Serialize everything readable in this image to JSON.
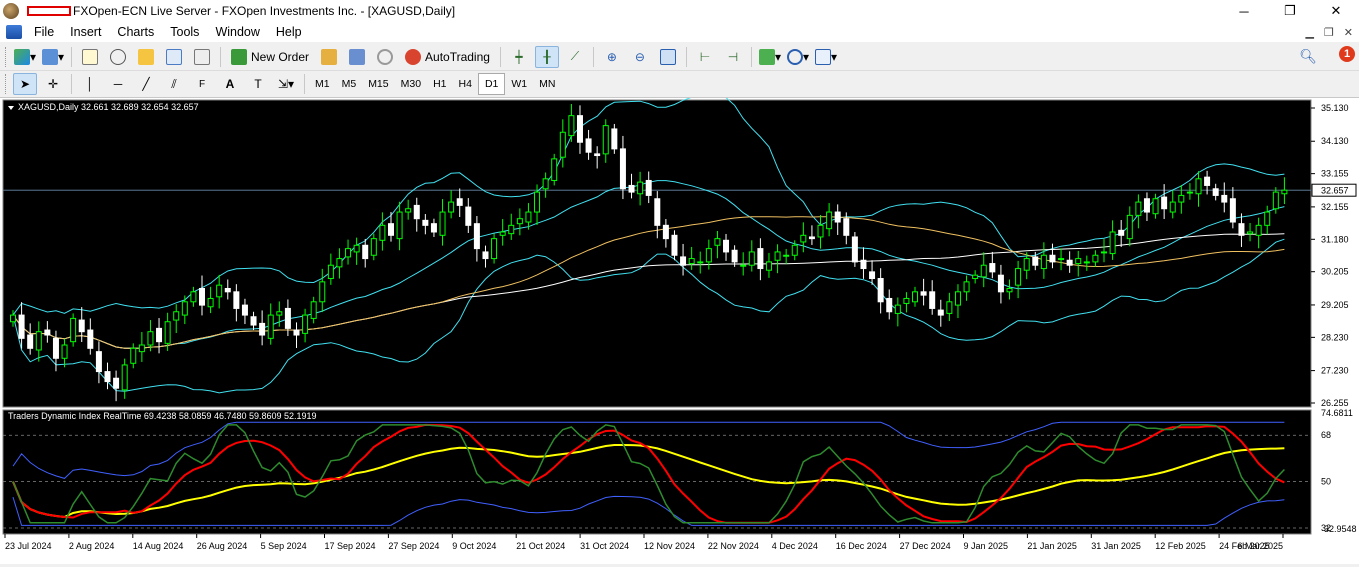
{
  "window": {
    "title": "FXOpen-ECN Live Server - FXOpen Investments Inc. - [XAGUSD,Daily]",
    "controls": [
      "─",
      "❐",
      "✕"
    ]
  },
  "menu": {
    "items": [
      "File",
      "Insert",
      "Charts",
      "Tools",
      "Window",
      "Help"
    ]
  },
  "toolbar": {
    "new_order": "New Order",
    "autotrading": "AutoTrading",
    "notification_count": "1"
  },
  "timeframes": [
    "M1",
    "M5",
    "M15",
    "M30",
    "H1",
    "H4",
    "D1",
    "W1",
    "MN"
  ],
  "selected_timeframe": "D1",
  "chart": {
    "symbol_label": "XAGUSD,Daily  32.661 32.689 32.654 32.657",
    "price_axis": [
      "35.130",
      "34.130",
      "33.155",
      "32.155",
      "31.180",
      "30.205",
      "29.205",
      "28.230",
      "27.230",
      "26.255"
    ],
    "current_price": "32.657",
    "indicator_label": "Traders Dynamic Index RealTime 69.4238 58.0859 46.7480 59.8609 52.1919",
    "indicator_axis": [
      "74.6811",
      "68",
      "50",
      "32",
      "32.9548"
    ],
    "date_axis": [
      "23 Jul 2024",
      "2 Aug 2024",
      "14 Aug 2024",
      "26 Aug 2024",
      "5 Sep 2024",
      "17 Sep 2024",
      "27 Sep 2024",
      "9 Oct 2024",
      "21 Oct 2024",
      "31 Oct 2024",
      "12 Nov 2024",
      "22 Nov 2024",
      "4 Dec 2024",
      "16 Dec 2024",
      "27 Dec 2024",
      "9 Jan 2025",
      "21 Jan 2025",
      "31 Jan 2025",
      "12 Feb 2025",
      "24 Feb 2025",
      "6 Mar 2025"
    ],
    "colors": {
      "background": "#000000",
      "bull_candle": "#00ff00",
      "bear_candle": "#ffffff",
      "bollinger": "#40e0f0",
      "ma_white": "#ffffff",
      "ma_orange": "#f0c060",
      "tdi_green": "#2e8b2e",
      "tdi_red": "#ff0000",
      "tdi_yellow": "#ffff00",
      "tdi_blue": "#4060ff"
    },
    "closes": [
      28.9,
      28.2,
      27.9,
      28.4,
      28.3,
      27.6,
      28.0,
      28.8,
      28.4,
      27.9,
      27.2,
      26.9,
      26.7,
      27.4,
      27.9,
      28.0,
      28.4,
      28.1,
      28.7,
      29.0,
      29.3,
      29.6,
      29.2,
      29.4,
      29.8,
      29.6,
      29.1,
      28.9,
      28.6,
      28.3,
      28.9,
      29.0,
      28.5,
      28.3,
      28.9,
      29.3,
      29.9,
      30.4,
      30.6,
      30.9,
      31.0,
      30.6,
      31.2,
      31.6,
      31.3,
      32.0,
      32.1,
      31.8,
      31.6,
      31.4,
      32.0,
      32.3,
      32.2,
      31.6,
      30.9,
      30.6,
      31.2,
      31.4,
      31.6,
      31.8,
      32.0,
      32.6,
      33.0,
      33.6,
      34.4,
      34.9,
      34.1,
      33.8,
      33.7,
      34.6,
      33.9,
      32.7,
      32.6,
      32.9,
      32.5,
      31.6,
      31.2,
      30.7,
      30.4,
      30.6,
      30.5,
      30.9,
      31.2,
      30.8,
      30.5,
      30.4,
      30.8,
      30.3,
      30.5,
      30.8,
      30.7,
      31.0,
      31.3,
      31.2,
      31.6,
      32.0,
      31.7,
      31.3,
      30.5,
      30.3,
      30.0,
      29.3,
      29.0,
      29.2,
      29.4,
      29.6,
      29.5,
      29.1,
      28.9,
      29.3,
      29.6,
      29.9,
      30.1,
      30.4,
      30.2,
      29.6,
      29.7,
      30.3,
      30.6,
      30.4,
      30.7,
      30.5,
      30.6,
      30.4,
      30.6,
      30.5,
      30.7,
      30.8,
      31.4,
      31.3,
      31.9,
      32.3,
      32.0,
      32.4,
      32.1,
      32.3,
      32.5,
      32.6,
      33.0,
      32.8,
      32.5,
      32.3,
      31.7,
      31.3,
      31.4,
      31.6,
      32.0,
      32.6,
      32.657
    ]
  }
}
